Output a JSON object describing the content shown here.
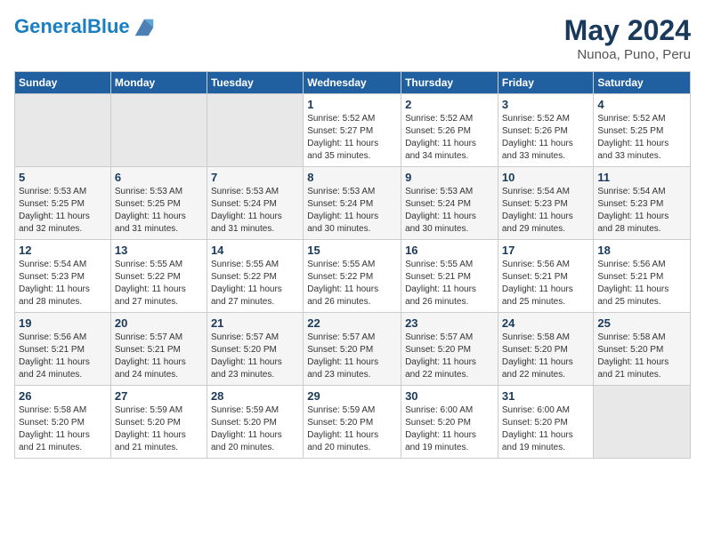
{
  "header": {
    "logo_line1": "General",
    "logo_line2": "Blue",
    "title": "May 2024",
    "subtitle": "Nunoa, Puno, Peru"
  },
  "weekdays": [
    "Sunday",
    "Monday",
    "Tuesday",
    "Wednesday",
    "Thursday",
    "Friday",
    "Saturday"
  ],
  "weeks": [
    [
      {
        "day": "",
        "info": ""
      },
      {
        "day": "",
        "info": ""
      },
      {
        "day": "",
        "info": ""
      },
      {
        "day": "1",
        "info": "Sunrise: 5:52 AM\nSunset: 5:27 PM\nDaylight: 11 hours\nand 35 minutes."
      },
      {
        "day": "2",
        "info": "Sunrise: 5:52 AM\nSunset: 5:26 PM\nDaylight: 11 hours\nand 34 minutes."
      },
      {
        "day": "3",
        "info": "Sunrise: 5:52 AM\nSunset: 5:26 PM\nDaylight: 11 hours\nand 33 minutes."
      },
      {
        "day": "4",
        "info": "Sunrise: 5:52 AM\nSunset: 5:25 PM\nDaylight: 11 hours\nand 33 minutes."
      }
    ],
    [
      {
        "day": "5",
        "info": "Sunrise: 5:53 AM\nSunset: 5:25 PM\nDaylight: 11 hours\nand 32 minutes."
      },
      {
        "day": "6",
        "info": "Sunrise: 5:53 AM\nSunset: 5:25 PM\nDaylight: 11 hours\nand 31 minutes."
      },
      {
        "day": "7",
        "info": "Sunrise: 5:53 AM\nSunset: 5:24 PM\nDaylight: 11 hours\nand 31 minutes."
      },
      {
        "day": "8",
        "info": "Sunrise: 5:53 AM\nSunset: 5:24 PM\nDaylight: 11 hours\nand 30 minutes."
      },
      {
        "day": "9",
        "info": "Sunrise: 5:53 AM\nSunset: 5:24 PM\nDaylight: 11 hours\nand 30 minutes."
      },
      {
        "day": "10",
        "info": "Sunrise: 5:54 AM\nSunset: 5:23 PM\nDaylight: 11 hours\nand 29 minutes."
      },
      {
        "day": "11",
        "info": "Sunrise: 5:54 AM\nSunset: 5:23 PM\nDaylight: 11 hours\nand 28 minutes."
      }
    ],
    [
      {
        "day": "12",
        "info": "Sunrise: 5:54 AM\nSunset: 5:23 PM\nDaylight: 11 hours\nand 28 minutes."
      },
      {
        "day": "13",
        "info": "Sunrise: 5:55 AM\nSunset: 5:22 PM\nDaylight: 11 hours\nand 27 minutes."
      },
      {
        "day": "14",
        "info": "Sunrise: 5:55 AM\nSunset: 5:22 PM\nDaylight: 11 hours\nand 27 minutes."
      },
      {
        "day": "15",
        "info": "Sunrise: 5:55 AM\nSunset: 5:22 PM\nDaylight: 11 hours\nand 26 minutes."
      },
      {
        "day": "16",
        "info": "Sunrise: 5:55 AM\nSunset: 5:21 PM\nDaylight: 11 hours\nand 26 minutes."
      },
      {
        "day": "17",
        "info": "Sunrise: 5:56 AM\nSunset: 5:21 PM\nDaylight: 11 hours\nand 25 minutes."
      },
      {
        "day": "18",
        "info": "Sunrise: 5:56 AM\nSunset: 5:21 PM\nDaylight: 11 hours\nand 25 minutes."
      }
    ],
    [
      {
        "day": "19",
        "info": "Sunrise: 5:56 AM\nSunset: 5:21 PM\nDaylight: 11 hours\nand 24 minutes."
      },
      {
        "day": "20",
        "info": "Sunrise: 5:57 AM\nSunset: 5:21 PM\nDaylight: 11 hours\nand 24 minutes."
      },
      {
        "day": "21",
        "info": "Sunrise: 5:57 AM\nSunset: 5:20 PM\nDaylight: 11 hours\nand 23 minutes."
      },
      {
        "day": "22",
        "info": "Sunrise: 5:57 AM\nSunset: 5:20 PM\nDaylight: 11 hours\nand 23 minutes."
      },
      {
        "day": "23",
        "info": "Sunrise: 5:57 AM\nSunset: 5:20 PM\nDaylight: 11 hours\nand 22 minutes."
      },
      {
        "day": "24",
        "info": "Sunrise: 5:58 AM\nSunset: 5:20 PM\nDaylight: 11 hours\nand 22 minutes."
      },
      {
        "day": "25",
        "info": "Sunrise: 5:58 AM\nSunset: 5:20 PM\nDaylight: 11 hours\nand 21 minutes."
      }
    ],
    [
      {
        "day": "26",
        "info": "Sunrise: 5:58 AM\nSunset: 5:20 PM\nDaylight: 11 hours\nand 21 minutes."
      },
      {
        "day": "27",
        "info": "Sunrise: 5:59 AM\nSunset: 5:20 PM\nDaylight: 11 hours\nand 21 minutes."
      },
      {
        "day": "28",
        "info": "Sunrise: 5:59 AM\nSunset: 5:20 PM\nDaylight: 11 hours\nand 20 minutes."
      },
      {
        "day": "29",
        "info": "Sunrise: 5:59 AM\nSunset: 5:20 PM\nDaylight: 11 hours\nand 20 minutes."
      },
      {
        "day": "30",
        "info": "Sunrise: 6:00 AM\nSunset: 5:20 PM\nDaylight: 11 hours\nand 19 minutes."
      },
      {
        "day": "31",
        "info": "Sunrise: 6:00 AM\nSunset: 5:20 PM\nDaylight: 11 hours\nand 19 minutes."
      },
      {
        "day": "",
        "info": ""
      }
    ]
  ]
}
